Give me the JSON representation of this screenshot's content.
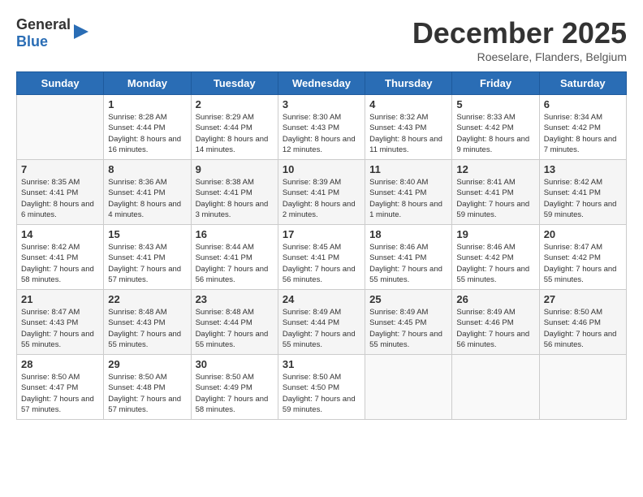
{
  "logo": {
    "line1": "General",
    "line2": "Blue"
  },
  "title": "December 2025",
  "location": "Roeselare, Flanders, Belgium",
  "days_of_week": [
    "Sunday",
    "Monday",
    "Tuesday",
    "Wednesday",
    "Thursday",
    "Friday",
    "Saturday"
  ],
  "weeks": [
    [
      {
        "day": "",
        "sunrise": "",
        "sunset": "",
        "daylight": ""
      },
      {
        "day": "1",
        "sunrise": "8:28 AM",
        "sunset": "4:44 PM",
        "daylight": "8 hours and 16 minutes."
      },
      {
        "day": "2",
        "sunrise": "8:29 AM",
        "sunset": "4:44 PM",
        "daylight": "8 hours and 14 minutes."
      },
      {
        "day": "3",
        "sunrise": "8:30 AM",
        "sunset": "4:43 PM",
        "daylight": "8 hours and 12 minutes."
      },
      {
        "day": "4",
        "sunrise": "8:32 AM",
        "sunset": "4:43 PM",
        "daylight": "8 hours and 11 minutes."
      },
      {
        "day": "5",
        "sunrise": "8:33 AM",
        "sunset": "4:42 PM",
        "daylight": "8 hours and 9 minutes."
      },
      {
        "day": "6",
        "sunrise": "8:34 AM",
        "sunset": "4:42 PM",
        "daylight": "8 hours and 7 minutes."
      }
    ],
    [
      {
        "day": "7",
        "sunrise": "8:35 AM",
        "sunset": "4:41 PM",
        "daylight": "8 hours and 6 minutes."
      },
      {
        "day": "8",
        "sunrise": "8:36 AM",
        "sunset": "4:41 PM",
        "daylight": "8 hours and 4 minutes."
      },
      {
        "day": "9",
        "sunrise": "8:38 AM",
        "sunset": "4:41 PM",
        "daylight": "8 hours and 3 minutes."
      },
      {
        "day": "10",
        "sunrise": "8:39 AM",
        "sunset": "4:41 PM",
        "daylight": "8 hours and 2 minutes."
      },
      {
        "day": "11",
        "sunrise": "8:40 AM",
        "sunset": "4:41 PM",
        "daylight": "8 hours and 1 minute."
      },
      {
        "day": "12",
        "sunrise": "8:41 AM",
        "sunset": "4:41 PM",
        "daylight": "7 hours and 59 minutes."
      },
      {
        "day": "13",
        "sunrise": "8:42 AM",
        "sunset": "4:41 PM",
        "daylight": "7 hours and 59 minutes."
      }
    ],
    [
      {
        "day": "14",
        "sunrise": "8:42 AM",
        "sunset": "4:41 PM",
        "daylight": "7 hours and 58 minutes."
      },
      {
        "day": "15",
        "sunrise": "8:43 AM",
        "sunset": "4:41 PM",
        "daylight": "7 hours and 57 minutes."
      },
      {
        "day": "16",
        "sunrise": "8:44 AM",
        "sunset": "4:41 PM",
        "daylight": "7 hours and 56 minutes."
      },
      {
        "day": "17",
        "sunrise": "8:45 AM",
        "sunset": "4:41 PM",
        "daylight": "7 hours and 56 minutes."
      },
      {
        "day": "18",
        "sunrise": "8:46 AM",
        "sunset": "4:41 PM",
        "daylight": "7 hours and 55 minutes."
      },
      {
        "day": "19",
        "sunrise": "8:46 AM",
        "sunset": "4:42 PM",
        "daylight": "7 hours and 55 minutes."
      },
      {
        "day": "20",
        "sunrise": "8:47 AM",
        "sunset": "4:42 PM",
        "daylight": "7 hours and 55 minutes."
      }
    ],
    [
      {
        "day": "21",
        "sunrise": "8:47 AM",
        "sunset": "4:43 PM",
        "daylight": "7 hours and 55 minutes."
      },
      {
        "day": "22",
        "sunrise": "8:48 AM",
        "sunset": "4:43 PM",
        "daylight": "7 hours and 55 minutes."
      },
      {
        "day": "23",
        "sunrise": "8:48 AM",
        "sunset": "4:44 PM",
        "daylight": "7 hours and 55 minutes."
      },
      {
        "day": "24",
        "sunrise": "8:49 AM",
        "sunset": "4:44 PM",
        "daylight": "7 hours and 55 minutes."
      },
      {
        "day": "25",
        "sunrise": "8:49 AM",
        "sunset": "4:45 PM",
        "daylight": "7 hours and 55 minutes."
      },
      {
        "day": "26",
        "sunrise": "8:49 AM",
        "sunset": "4:46 PM",
        "daylight": "7 hours and 56 minutes."
      },
      {
        "day": "27",
        "sunrise": "8:50 AM",
        "sunset": "4:46 PM",
        "daylight": "7 hours and 56 minutes."
      }
    ],
    [
      {
        "day": "28",
        "sunrise": "8:50 AM",
        "sunset": "4:47 PM",
        "daylight": "7 hours and 57 minutes."
      },
      {
        "day": "29",
        "sunrise": "8:50 AM",
        "sunset": "4:48 PM",
        "daylight": "7 hours and 57 minutes."
      },
      {
        "day": "30",
        "sunrise": "8:50 AM",
        "sunset": "4:49 PM",
        "daylight": "7 hours and 58 minutes."
      },
      {
        "day": "31",
        "sunrise": "8:50 AM",
        "sunset": "4:50 PM",
        "daylight": "7 hours and 59 minutes."
      },
      {
        "day": "",
        "sunrise": "",
        "sunset": "",
        "daylight": ""
      },
      {
        "day": "",
        "sunrise": "",
        "sunset": "",
        "daylight": ""
      },
      {
        "day": "",
        "sunrise": "",
        "sunset": "",
        "daylight": ""
      }
    ]
  ],
  "labels": {
    "sunrise": "Sunrise:",
    "sunset": "Sunset:",
    "daylight": "Daylight:"
  }
}
